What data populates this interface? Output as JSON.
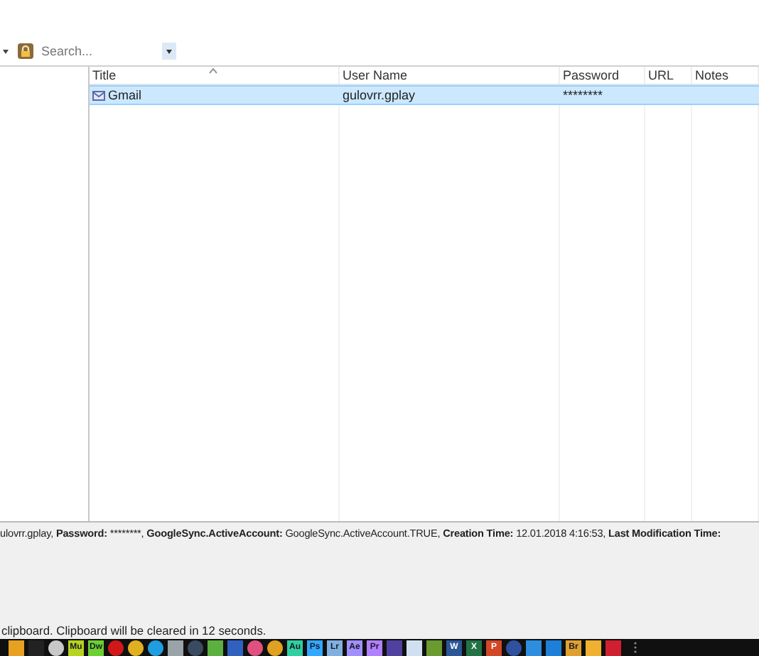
{
  "toolbar": {
    "search": {
      "placeholder": "Search..."
    }
  },
  "entries": {
    "columns": [
      {
        "label": "Title",
        "sorted": true
      },
      {
        "label": "User Name",
        "sorted": false
      },
      {
        "label": "Password",
        "sorted": false
      },
      {
        "label": "URL",
        "sorted": false
      },
      {
        "label": "Notes",
        "sorted": false
      }
    ],
    "rows": [
      {
        "title": "Gmail",
        "user_name": "gulovrr.gplay",
        "password": "********",
        "selected": true
      }
    ]
  },
  "details": [
    {
      "text": "ulovrr.gplay, ",
      "bold": false
    },
    {
      "text": "Password:",
      "bold": true
    },
    {
      "text": " ********, ",
      "bold": false
    },
    {
      "text": "GoogleSync.ActiveAccount:",
      "bold": true
    },
    {
      "text": " GoogleSync.ActiveAccount.TRUE, ",
      "bold": false
    },
    {
      "text": "Creation Time:",
      "bold": true
    },
    {
      "text": " 12.01.2018 4:16:53, ",
      "bold": false
    },
    {
      "text": "Last Modification Time:",
      "bold": true
    }
  ],
  "status_bar": "clipboard. Clipboard will be cleared in 12 seconds.",
  "taskbar": [
    {
      "kind": "tile",
      "color": "#e8a020"
    },
    {
      "kind": "tile",
      "color": "#222222"
    },
    {
      "kind": "round",
      "color": "#c8c8c8"
    },
    {
      "kind": "letter",
      "label": "Mu",
      "color": "#b7d31e"
    },
    {
      "kind": "letter",
      "label": "Dw",
      "color": "#6bd030"
    },
    {
      "kind": "round",
      "color": "#d01818"
    },
    {
      "kind": "round",
      "color": "#e0b020"
    },
    {
      "kind": "round",
      "color": "#1e9de0"
    },
    {
      "kind": "tile",
      "color": "#9aa4a8"
    },
    {
      "kind": "round",
      "color": "#3a4a60"
    },
    {
      "kind": "tile",
      "color": "#5cb040"
    },
    {
      "kind": "tile",
      "color": "#3060c0"
    },
    {
      "kind": "round",
      "color": "#e05080"
    },
    {
      "kind": "round",
      "color": "#e0a020"
    },
    {
      "kind": "letter",
      "label": "Au",
      "color": "#2fd0a0"
    },
    {
      "kind": "letter",
      "label": "Ps",
      "color": "#31a8ff"
    },
    {
      "kind": "letter",
      "label": "Lr",
      "color": "#7fb0e0"
    },
    {
      "kind": "letter",
      "label": "Ae",
      "color": "#a090ff"
    },
    {
      "kind": "letter",
      "label": "Pr",
      "color": "#b080ff"
    },
    {
      "kind": "tile",
      "color": "#5040a0"
    },
    {
      "kind": "tile",
      "color": "#d0e0f0"
    },
    {
      "kind": "tile",
      "color": "#6a9a30"
    },
    {
      "kind": "solid",
      "label": "W",
      "color": "#2b5797"
    },
    {
      "kind": "solid",
      "label": "X",
      "color": "#217346"
    },
    {
      "kind": "solid",
      "label": "P",
      "color": "#d24726"
    },
    {
      "kind": "round",
      "color": "#3050a0"
    },
    {
      "kind": "tile",
      "color": "#2d8ee0"
    },
    {
      "kind": "tile",
      "color": "#1e7fd8"
    },
    {
      "kind": "letter",
      "label": "Br",
      "color": "#e0a030"
    },
    {
      "kind": "tile",
      "color": "#f0b030"
    },
    {
      "kind": "tile",
      "color": "#d02030"
    }
  ]
}
